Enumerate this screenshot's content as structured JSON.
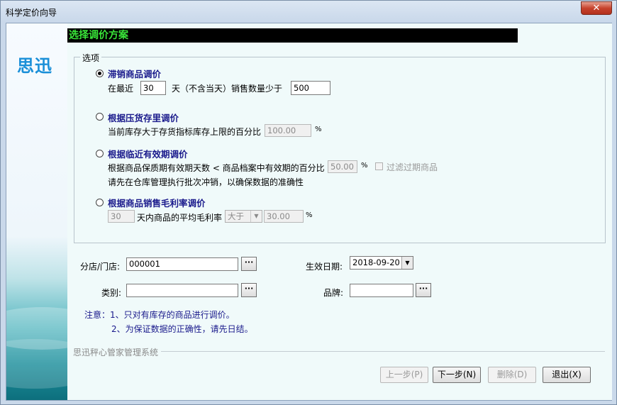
{
  "window": {
    "title": "科学定价向导",
    "close_glyph": "✕"
  },
  "sidebar": {
    "logo": "思迅"
  },
  "header": {
    "title": "选择调价方案"
  },
  "options_group": {
    "legend": "选项",
    "opt1": {
      "label": "滞销商品调价",
      "selected": true,
      "text_prefix": "在最近",
      "days": "30",
      "text_mid": "天（不含当天）销售数量少于",
      "quantity": "500"
    },
    "opt2": {
      "label": "根据压货存里调价",
      "selected": false,
      "text": "当前库存大于存货指标库存上限的百分比",
      "percent": "100.00",
      "unit": "%"
    },
    "opt3": {
      "label": "根据临近有效期调价",
      "selected": false,
      "text": "根据商品保质期有效期天数 < 商品档案中有效期的百分比",
      "percent": "50.00",
      "unit": "%",
      "filter_label": "过滤过期商品",
      "filter_checked": false,
      "hint": "请先在仓库管理执行批次冲销，以确保数据的准确性"
    },
    "opt4": {
      "label": "根据商品销售毛利率调价",
      "selected": false,
      "days": "30",
      "text": "天内商品的平均毛利率",
      "compare": "大于",
      "percent": "30.00",
      "unit": "%"
    }
  },
  "fields": {
    "branch_label": "分店/门店:",
    "branch_value": "000001",
    "effective_date_label": "生效日期:",
    "effective_date_value": "2018-09-20",
    "category_label": "类别:",
    "category_value": "",
    "brand_label": "品牌:",
    "brand_value": "",
    "lookup_glyph": "···"
  },
  "notes": {
    "line1": "注意：1、只对有库存的商品进行调价。",
    "line2": "2、为保证数据的正确性，请先日结。"
  },
  "footer": {
    "system_name": "思迅秤心管家管理系统"
  },
  "buttons": {
    "prev": "上一步(P)",
    "next": "下一步(N)",
    "delete": "删除(D)",
    "exit": "退出(X)"
  }
}
